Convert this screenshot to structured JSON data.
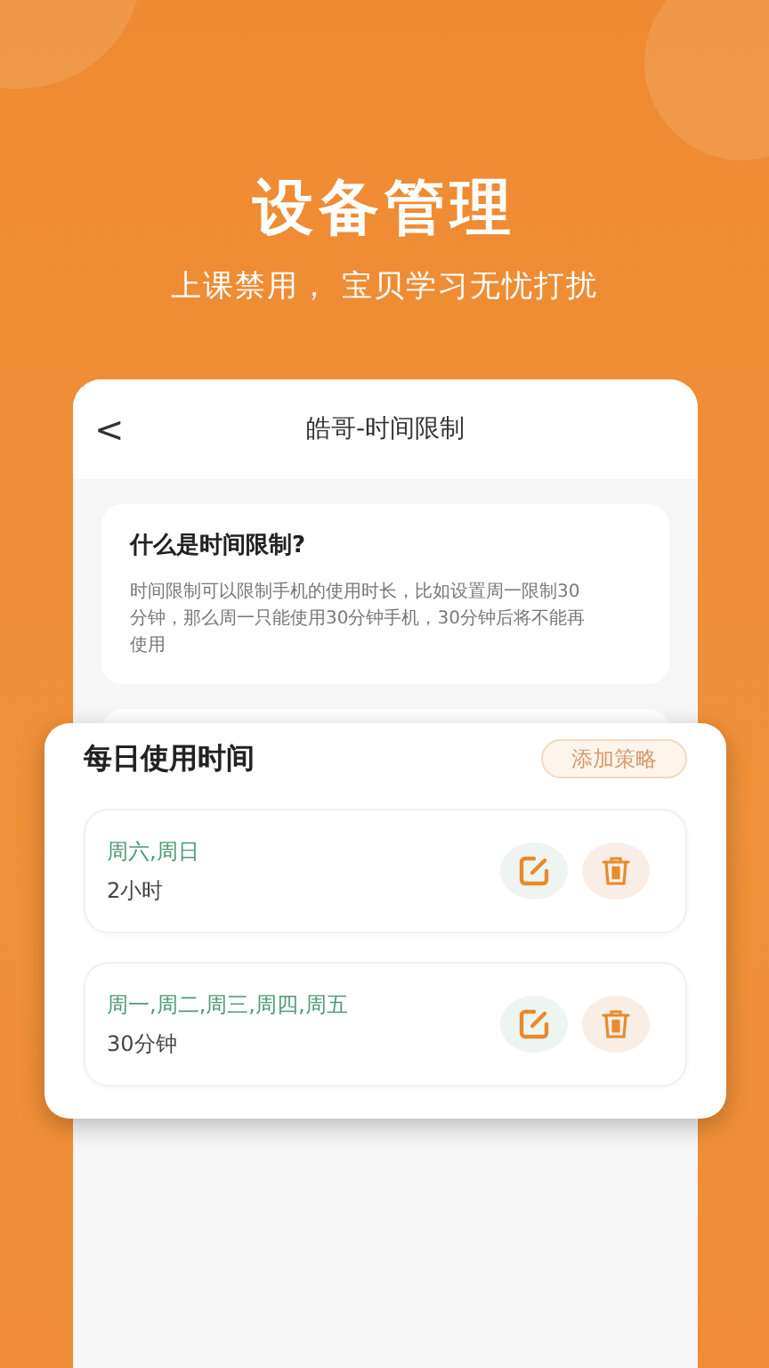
{
  "hero": {
    "title": "设备管理",
    "subtitle": "上课禁用， 宝贝学习无忧打扰"
  },
  "phone": {
    "back": "<",
    "title": "皓哥-时间限制",
    "info": {
      "title": "什么是时间限制?",
      "text": "时间限制可以限制手机的使用时长，比如设置周一限制30分钟，那么周一只能使用30分钟手机，30分钟后将不能再使用"
    }
  },
  "popup": {
    "title": "每日使用时间",
    "add_button": "添加策略",
    "rules": [
      {
        "days": "周六,周日",
        "duration": "2小时"
      },
      {
        "days": "周一,周二,周三,周四,周五",
        "duration": "30分钟"
      }
    ]
  }
}
